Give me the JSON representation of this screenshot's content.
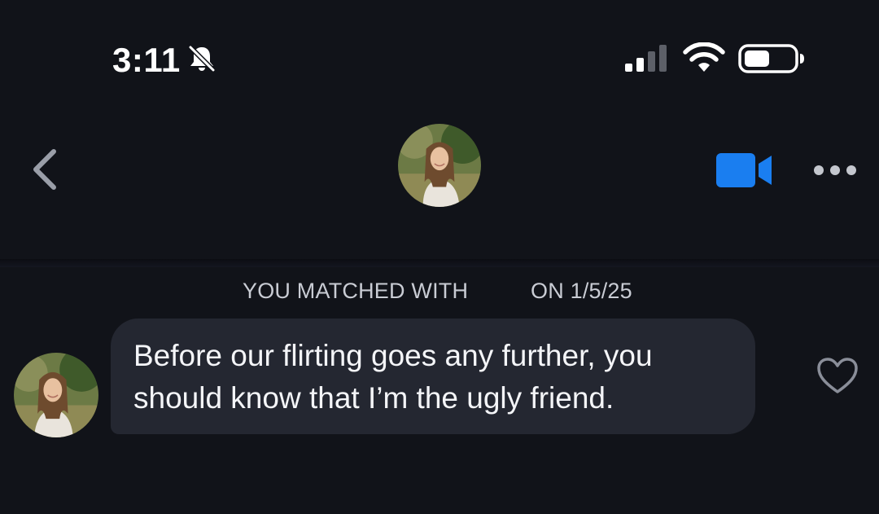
{
  "status_bar": {
    "time": "3:11",
    "icons": [
      "bell-slash-icon",
      "signal-icon",
      "wifi-icon",
      "battery-icon"
    ],
    "signal_bars_active": 2,
    "battery_level": 0.5
  },
  "header": {
    "back_icon": "chevron-left-icon",
    "avatar": "profile-photo",
    "video_icon": "video-camera-icon",
    "more_icon": "more-dots-icon"
  },
  "chat": {
    "match_notice_left": "YOU MATCHED WITH",
    "match_notice_right": "ON 1/5/25",
    "messages": [
      {
        "sender": "them",
        "text": "Before our flirting goes any further, you\nshould know that I’m the ugly friend.",
        "liked": false
      }
    ]
  },
  "colors": {
    "background": "#111319",
    "bubble": "#242731",
    "accent_blue": "#1a7ef0",
    "muted_text": "#c9ccd4",
    "icon_gray": "#8a8e99"
  }
}
